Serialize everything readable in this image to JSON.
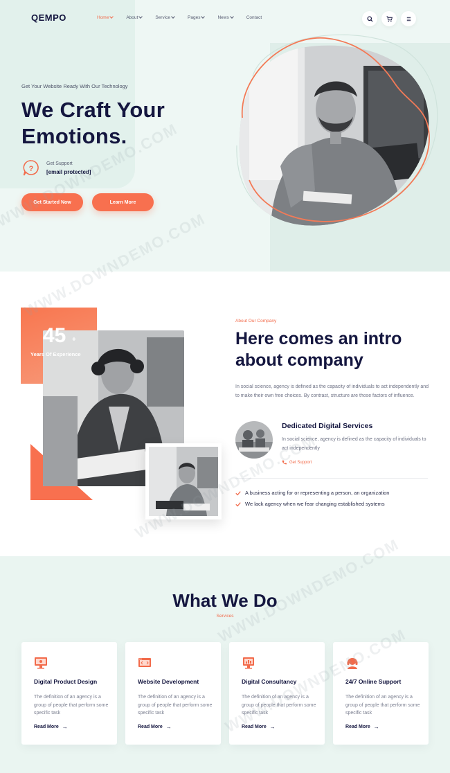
{
  "header": {
    "logo": "QEMPO",
    "nav": [
      {
        "label": "Home",
        "active": true,
        "dropdown": true
      },
      {
        "label": "About",
        "active": false,
        "dropdown": true
      },
      {
        "label": "Service",
        "active": false,
        "dropdown": true
      },
      {
        "label": "Pages",
        "active": false,
        "dropdown": true
      },
      {
        "label": "News",
        "active": false,
        "dropdown": true
      },
      {
        "label": "Contact",
        "active": false,
        "dropdown": false
      }
    ],
    "icons": [
      "search-icon",
      "cart-icon",
      "menu-icon"
    ]
  },
  "hero": {
    "tagline": "Get Your Website Ready With Our Technology",
    "title_line1": "We Craft Your",
    "title_line2": "Emotions.",
    "support_label": "Get Support",
    "support_email": "[email protected]",
    "btn_primary": "Get Started Now",
    "btn_secondary": "Learn More"
  },
  "about": {
    "experience_number": "45",
    "experience_suffix": "+",
    "experience_label": "Years Of Experience",
    "tag": "About Our Company",
    "title_line1": "Here comes an intro",
    "title_line2": "about company",
    "description": "In social science, agency is defined as the capacity of individuals to act independently and to make their own free choices. By contrast, structure are those factors of influence.",
    "service_title": "Dedicated Digital Services",
    "service_description": "In social science, agency is defined as the capacity of individuals to act independently",
    "service_link": "Get Support",
    "checks": [
      "A business acting for or representing a person, an organization",
      "We lack agency when we fear changing established systems"
    ]
  },
  "services": {
    "heading": "What We Do",
    "subheading": "Services",
    "cards": [
      {
        "title": "Digital Product Design",
        "description": "The definition of an agency is a group of people that perform some specific task",
        "link": "Read More",
        "icon": "monitor-icon"
      },
      {
        "title": "Website Development",
        "description": "The definition of an agency is a group of people that perform some specific task",
        "link": "Read More",
        "icon": "browser-code-icon"
      },
      {
        "title": "Digital Consultancy",
        "description": "The definition of an agency is a group of people that perform some specific task",
        "link": "Read More",
        "icon": "consultancy-screen-icon"
      },
      {
        "title": "24/7 Online Support",
        "description": "The definition of an agency is a group of people that perform some specific task",
        "link": "Read More",
        "icon": "headset-icon"
      }
    ]
  },
  "watermark": "WWW.DOWNDEMO.COM",
  "colors": {
    "accent": "#f26b4b",
    "navy": "#14163f",
    "hero_bg": "#eef7f4",
    "services_bg": "#eaf5f1"
  }
}
